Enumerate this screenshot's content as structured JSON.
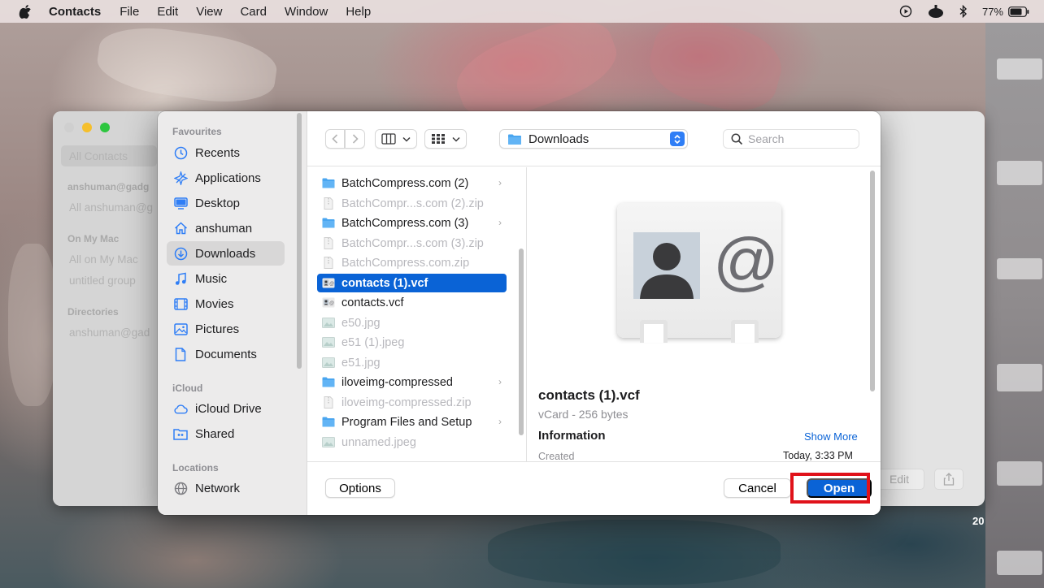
{
  "menubar": {
    "app_name": "Contacts",
    "items": [
      "File",
      "Edit",
      "View",
      "Card",
      "Window",
      "Help"
    ],
    "battery_percent": "77%"
  },
  "contacts_window": {
    "sidebar": {
      "all_contacts": "All Contacts",
      "account_group": "anshuman@gadg",
      "account_item": "All anshuman@g",
      "on_my_mac_group": "On My Mac",
      "on_my_mac_item": "All on My Mac",
      "untitled_group": "untitled group",
      "directories_group": "Directories",
      "directories_item": "anshuman@gad"
    },
    "edit_label": "Edit",
    "clock_fragment": "20"
  },
  "dialog": {
    "sidebar": {
      "favourites_header": "Favourites",
      "favourites": [
        {
          "label": "Recents",
          "icon": "clock-icon"
        },
        {
          "label": "Applications",
          "icon": "applications-icon"
        },
        {
          "label": "Desktop",
          "icon": "desktop-icon"
        },
        {
          "label": "anshuman",
          "icon": "home-icon"
        },
        {
          "label": "Downloads",
          "icon": "downloads-icon"
        },
        {
          "label": "Music",
          "icon": "music-icon"
        },
        {
          "label": "Movies",
          "icon": "movies-icon"
        },
        {
          "label": "Pictures",
          "icon": "pictures-icon"
        },
        {
          "label": "Documents",
          "icon": "documents-icon"
        }
      ],
      "icloud_header": "iCloud",
      "icloud": [
        {
          "label": "iCloud Drive",
          "icon": "cloud-icon"
        },
        {
          "label": "Shared",
          "icon": "shared-folder-icon"
        }
      ],
      "locations_header": "Locations",
      "locations": [
        {
          "label": "Network",
          "icon": "globe-icon"
        }
      ],
      "active_item": "Downloads"
    },
    "toolbar": {
      "location": "Downloads",
      "search_placeholder": "Search"
    },
    "files": [
      {
        "name": "BatchCompress.com (2)",
        "kind": "folder",
        "dim": false,
        "has_children": true
      },
      {
        "name": "BatchCompr...s.com (2).zip",
        "kind": "zip",
        "dim": true,
        "has_children": false
      },
      {
        "name": "BatchCompress.com (3)",
        "kind": "folder",
        "dim": false,
        "has_children": true
      },
      {
        "name": "BatchCompr...s.com (3).zip",
        "kind": "zip",
        "dim": true,
        "has_children": false
      },
      {
        "name": "BatchCompress.com.zip",
        "kind": "zip",
        "dim": true,
        "has_children": false
      },
      {
        "name": "contacts (1).vcf",
        "kind": "vcard",
        "dim": false,
        "has_children": false,
        "selected": true
      },
      {
        "name": "contacts.vcf",
        "kind": "vcard",
        "dim": false,
        "has_children": false
      },
      {
        "name": "e50.jpg",
        "kind": "image",
        "dim": true,
        "has_children": false
      },
      {
        "name": "e51 (1).jpeg",
        "kind": "image",
        "dim": true,
        "has_children": false
      },
      {
        "name": "e51.jpg",
        "kind": "image",
        "dim": true,
        "has_children": false
      },
      {
        "name": "iloveimg-compressed",
        "kind": "folder",
        "dim": false,
        "has_children": true
      },
      {
        "name": "iloveimg-compressed.zip",
        "kind": "zip",
        "dim": true,
        "has_children": false
      },
      {
        "name": "Program Files and Setup",
        "kind": "folder",
        "dim": false,
        "has_children": true
      },
      {
        "name": "unnamed.jpeg",
        "kind": "image",
        "dim": true,
        "has_children": false
      }
    ],
    "preview": {
      "name": "contacts (1).vcf",
      "kind": "vCard - 256 bytes",
      "info_header": "Information",
      "show_more": "Show More",
      "created_label": "Created",
      "created_value": "Today, 3:33 PM"
    },
    "buttons": {
      "options": "Options",
      "cancel": "Cancel",
      "open": "Open"
    }
  },
  "colors": {
    "accent": "#0a63d6",
    "highlight_box": "#e0121a",
    "folder": "#4aa6f0"
  }
}
